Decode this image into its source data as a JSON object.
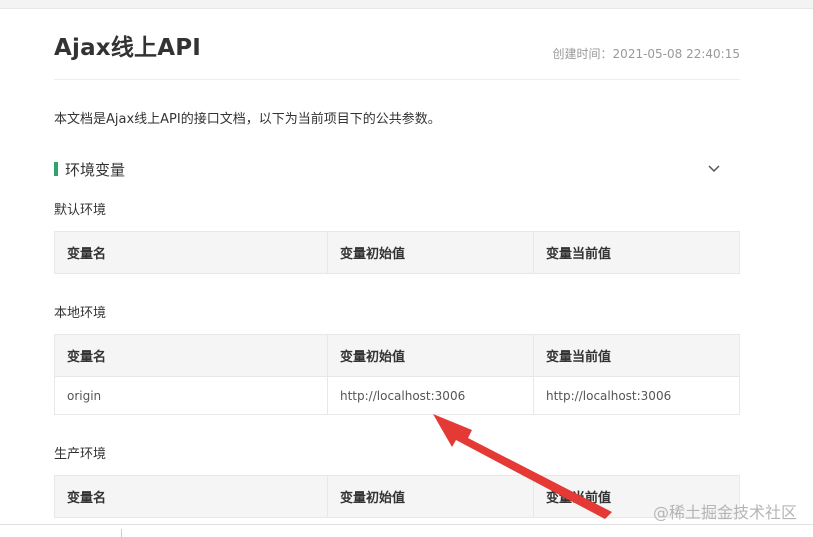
{
  "doc": {
    "title": "Ajax线上API",
    "created_label": "创建时间：",
    "created_value": "2021-05-08 22:40:15",
    "description": "本文档是Ajax线上API的接口文档，以下为当前项目下的公共参数。"
  },
  "section": {
    "title": "环境变量",
    "toggle_icon": "chevron-down-icon"
  },
  "columns": {
    "name": "变量名",
    "initial": "变量初始值",
    "current": "变量当前值"
  },
  "environments": {
    "default": {
      "label": "默认环境"
    },
    "local": {
      "label": "本地环境",
      "rows": [
        {
          "name": "origin",
          "initial": "http://localhost:3006",
          "current": "http://localhost:3006"
        }
      ]
    },
    "production": {
      "label": "生产环境"
    }
  },
  "watermark": "@稀土掘金技术社区",
  "colors": {
    "accent": "#2fa36b",
    "arrow": "#e53935"
  }
}
